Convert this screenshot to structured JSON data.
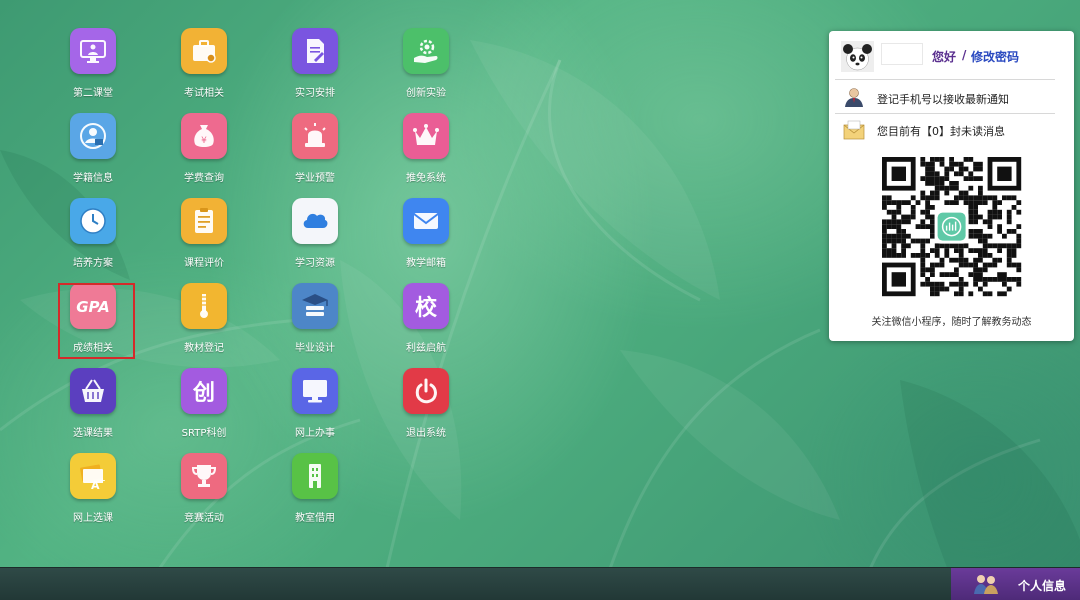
{
  "apps": [
    {
      "label": "第二课堂",
      "icon": "monitor-person-icon",
      "color": "#a566e8"
    },
    {
      "label": "考试相关",
      "icon": "briefcase-icon",
      "color": "#f2b235"
    },
    {
      "label": "实习安排",
      "icon": "document-pen-icon",
      "color": "#7a55e0"
    },
    {
      "label": "创新实验",
      "icon": "hand-gear-icon",
      "color": "#4cc06a"
    },
    {
      "label": "学籍信息",
      "icon": "student-card-icon",
      "color": "#5aa6e6"
    },
    {
      "label": "学费查询",
      "icon": "money-bag-icon",
      "color": "#ee6a8f"
    },
    {
      "label": "学业预警",
      "icon": "alarm-light-icon",
      "color": "#ee6a80"
    },
    {
      "label": "推免系统",
      "icon": "crown-icon",
      "color": "#ea5d95"
    },
    {
      "label": "培养方案",
      "icon": "clock-icon",
      "color": "#49a8e8"
    },
    {
      "label": "课程评价",
      "icon": "clipboard-list-icon",
      "color": "#f2b235"
    },
    {
      "label": "学习资源",
      "icon": "cloud-icon",
      "color": "#f4f6fa"
    },
    {
      "label": "教学邮箱",
      "icon": "mail-icon",
      "color": "#3f86f0"
    },
    {
      "label": "成绩相关",
      "icon": "gpa-icon",
      "color": "#ef7a96",
      "text": "GPA"
    },
    {
      "label": "教材登记",
      "icon": "zipper-folder-icon",
      "color": "#f2b630"
    },
    {
      "label": "毕业设计",
      "icon": "graduation-server-icon",
      "color": "#4d86c8"
    },
    {
      "label": "利兹启航",
      "icon": "school-char-icon",
      "color": "#a35be0",
      "text": "校"
    },
    {
      "label": "选课结果",
      "icon": "basket-icon",
      "color": "#5b3fbf"
    },
    {
      "label": "SRTP科创",
      "icon": "chuang-char-icon",
      "color": "#a35be0",
      "text": "创"
    },
    {
      "label": "网上办事",
      "icon": "computer-icon",
      "color": "#5a66e6"
    },
    {
      "label": "退出系统",
      "icon": "power-icon",
      "color": "#e23a47"
    },
    {
      "label": "网上选课",
      "icon": "grade-a-plus-icon",
      "color": "#f4cc38"
    },
    {
      "label": "竞赛活动",
      "icon": "trophy-icon",
      "color": "#ee6a80"
    },
    {
      "label": "教室借用",
      "icon": "building-icon",
      "color": "#58c246"
    }
  ],
  "user_panel": {
    "greeting": "您好",
    "separator": "/",
    "change_password": "修改密码",
    "phone_notice": "登记手机号以接收最新通知",
    "unread_notice": "您目前有【0】封未读消息",
    "qr_caption": "关注微信小程序，随时了解教务动态"
  },
  "bottom_bar": {
    "personal_info": "个人信息"
  },
  "colors": {
    "highlight_box": "#d42a2a",
    "greeting": "#5a2f8f",
    "link": "#2a49c0",
    "personal_info_button": "#5a3088"
  }
}
